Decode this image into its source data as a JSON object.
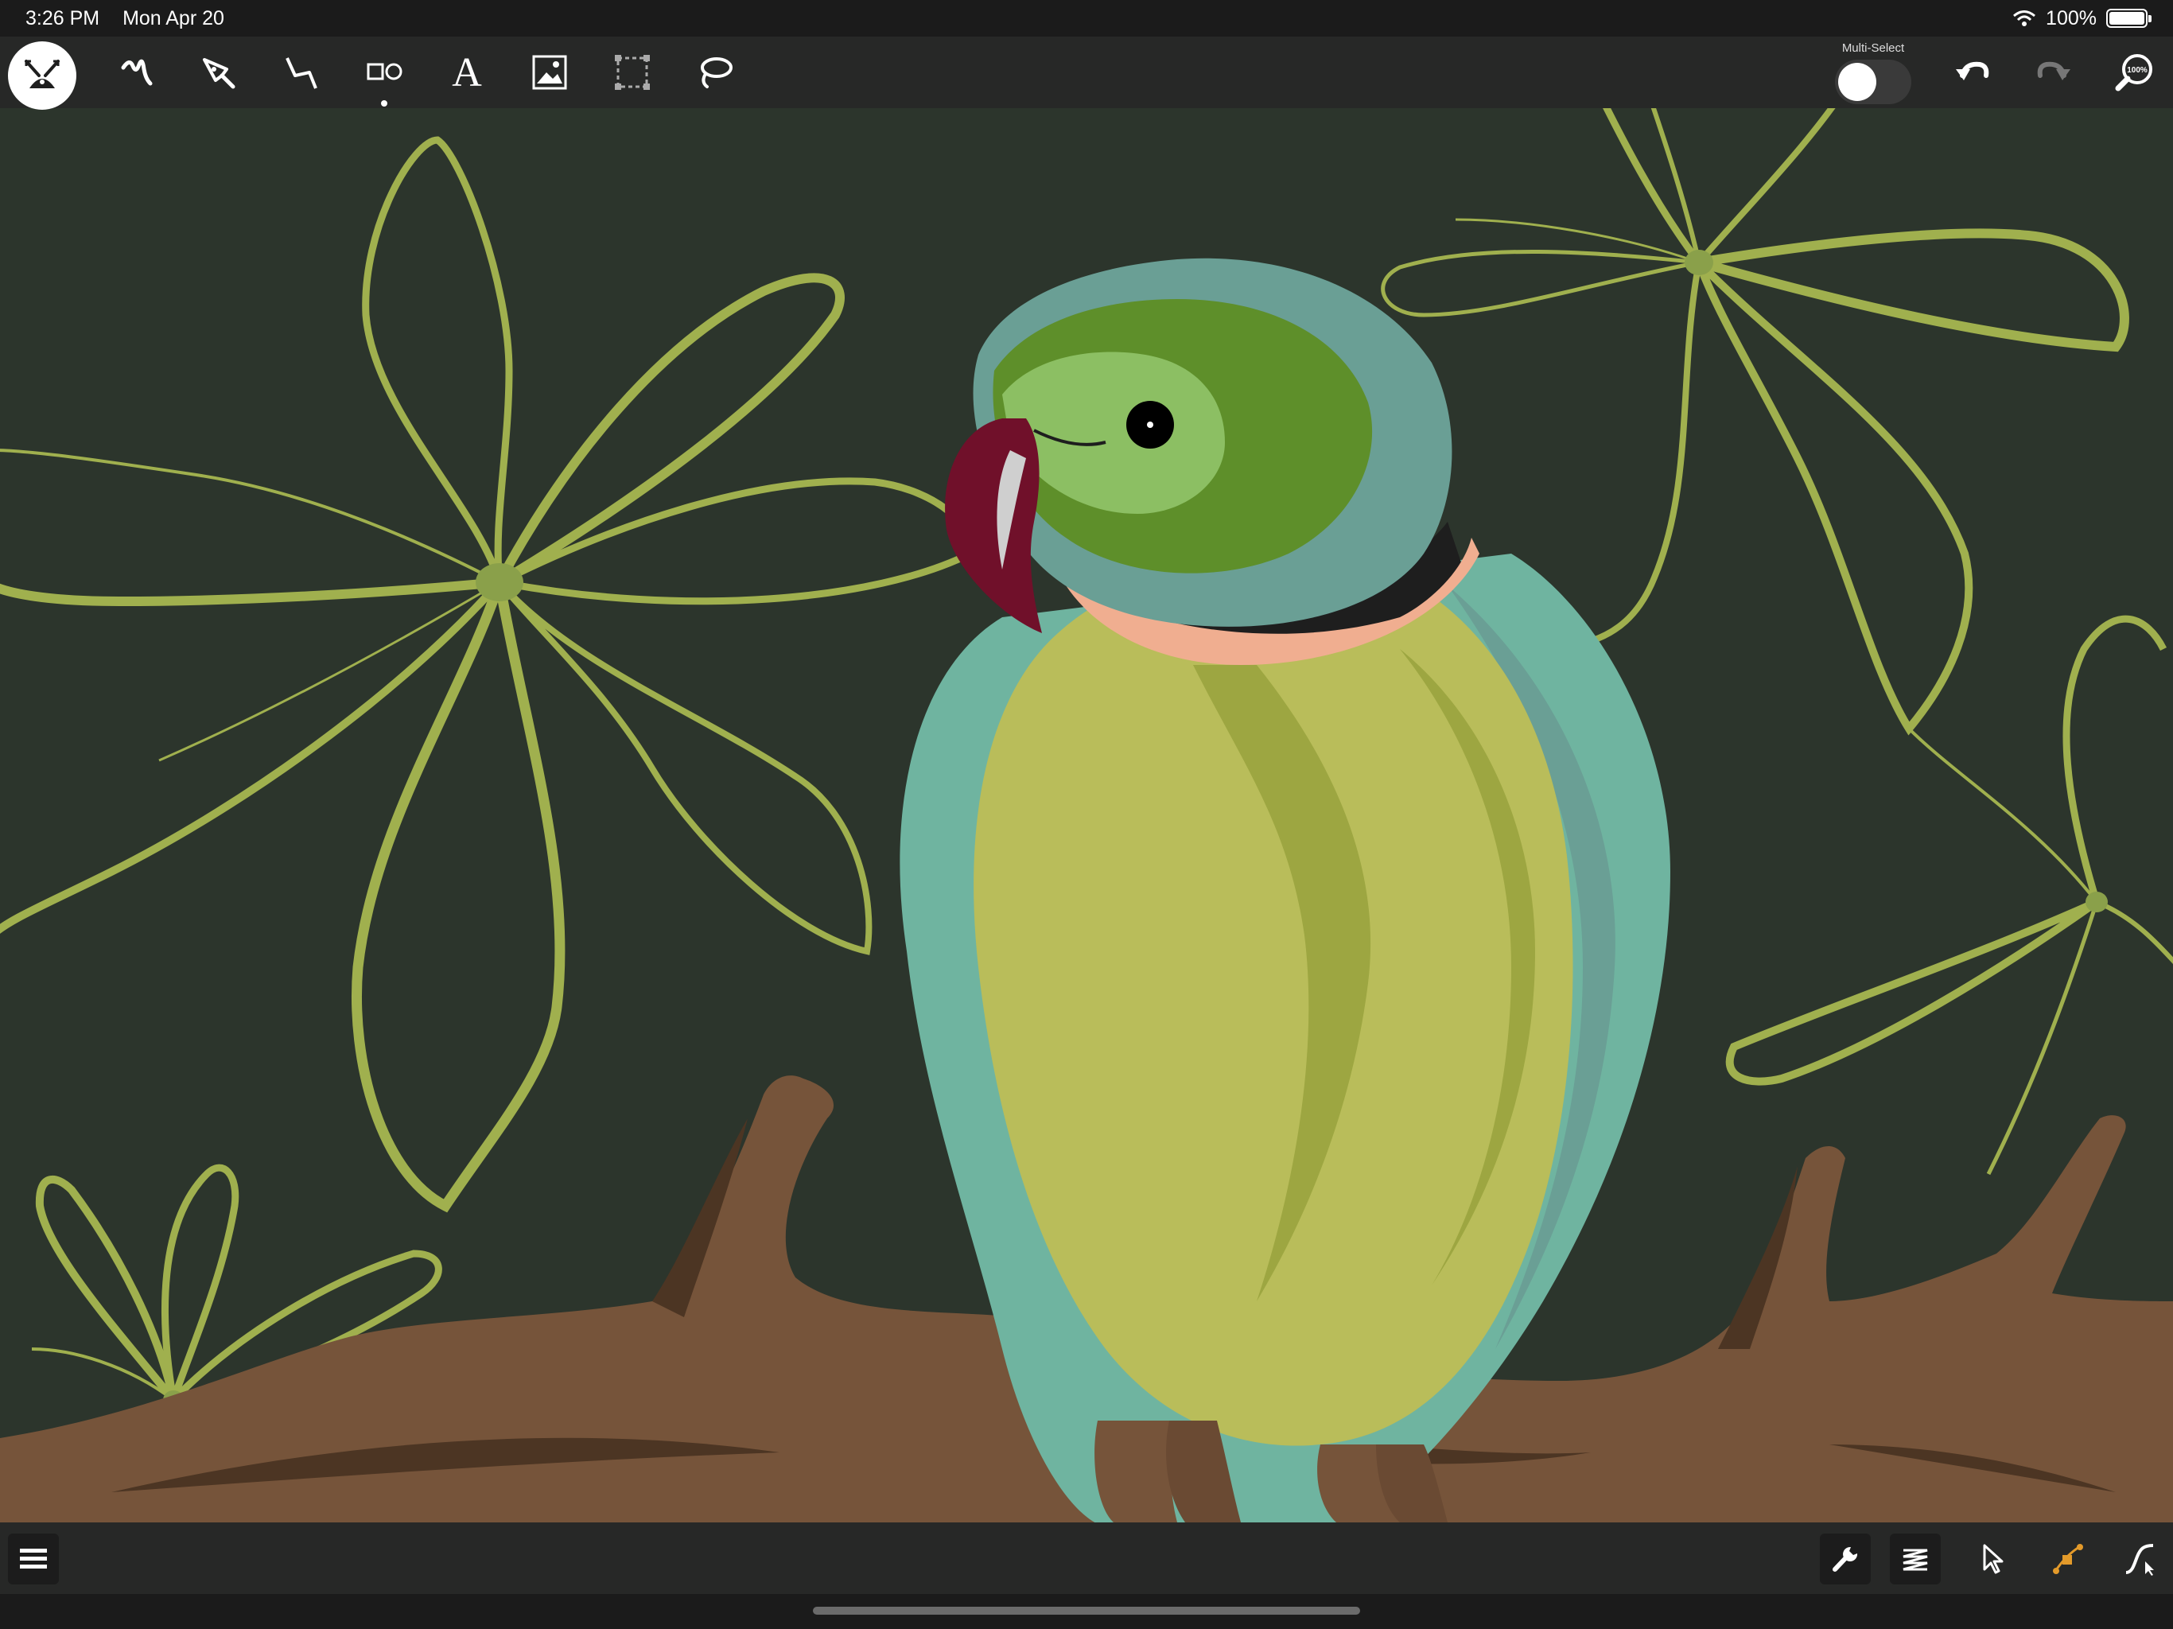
{
  "status_bar": {
    "time": "3:26 PM",
    "date": "Mon Apr 20",
    "battery": "100%"
  },
  "toolbar": {
    "tools": [
      {
        "name": "brush-tool",
        "icon": "squiggle-icon"
      },
      {
        "name": "pen-tool",
        "icon": "pen-nib-icon"
      },
      {
        "name": "line-tool",
        "icon": "polyline-icon"
      },
      {
        "name": "shape-tool",
        "icon": "shapes-icon",
        "active": true
      },
      {
        "name": "text-tool",
        "icon": "text-a-icon"
      },
      {
        "name": "image-tool",
        "icon": "image-icon"
      },
      {
        "name": "artboard-tool",
        "icon": "artboard-icon"
      },
      {
        "name": "lasso-tool",
        "icon": "lasso-icon"
      }
    ],
    "text_tool_glyph": "A",
    "multi_select_label": "Multi-Select",
    "multi_select_on": false,
    "zoom_label": "100%"
  },
  "bottom_toolbar": {
    "items": [
      "menu-icon",
      "wrench-icon",
      "layers-icon",
      "pointer-icon",
      "node-icon",
      "bezier-icon"
    ]
  },
  "colors": {
    "canvas_bg": "#2c352c",
    "petal": "#a0b04e",
    "branch": "#76543a",
    "branch_dark": "#4c3523",
    "parrot_body": "#b9bd5a",
    "parrot_belly_shade": "#9da641",
    "parrot_blue": "#6fb4a0",
    "parrot_teal": "#6a9f95",
    "parrot_head": "#8cbf63",
    "beak": "#70102a",
    "accent_orange": "#e39a2a"
  }
}
